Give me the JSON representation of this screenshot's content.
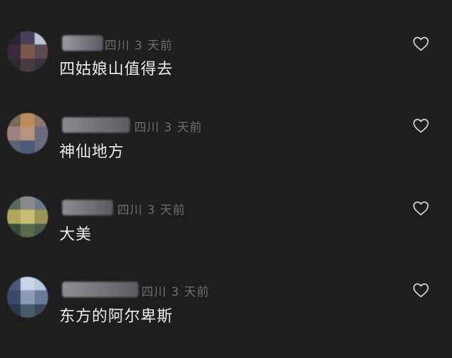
{
  "comments": [
    {
      "location": "四川",
      "time": "3 天前",
      "text": "四姑娘山值得去",
      "avatar_colors": [
        "#2a2436",
        "#46405a",
        "#b8c4d0",
        "#3a2a3c",
        "#7a5a4c",
        "#5a4a52",
        "#2c2a30",
        "#4a3a42",
        "#38343a"
      ],
      "username_colors": [
        "#9a9aa2",
        "#5a5a62"
      ],
      "like_icon": "heart-outline-icon"
    },
    {
      "location": "四川",
      "time": "3 天前",
      "text": "神仙地方",
      "avatar_colors": [
        "#7a6a56",
        "#c08a5a",
        "#8a7a70",
        "#a0807a",
        "#b89480",
        "#6a6a80",
        "#5a6470",
        "#4a5a78",
        "#6a6e7a"
      ],
      "username_colors": [
        "#8a8a90",
        "#5c5c62"
      ],
      "like_icon": "heart-outline-icon"
    },
    {
      "location": "四川",
      "time": "3 天前",
      "text": "大美",
      "avatar_colors": [
        "#5a6a5a",
        "#8a8a8a",
        "#6a7a8a",
        "#b0a860",
        "#c8be70",
        "#9a9458",
        "#3a4a3a",
        "#5a6a4a",
        "#4a5a4a"
      ],
      "username_colors": [
        "#8c8c92",
        "#5a5a60"
      ],
      "like_icon": "heart-outline-icon"
    },
    {
      "location": "四川",
      "time": "3 天前",
      "text": "东方的阿尔卑斯",
      "avatar_colors": [
        "#4a5a7a",
        "#c8d4e8",
        "#b8c8e0",
        "#3a4a6a",
        "#8a9ab8",
        "#6a7a98",
        "#2a3a4a",
        "#4a5a6a",
        "#3a4858"
      ],
      "username_colors": [
        "#8e8e94",
        "#5c5c62"
      ],
      "like_icon": "heart-outline-icon"
    }
  ]
}
